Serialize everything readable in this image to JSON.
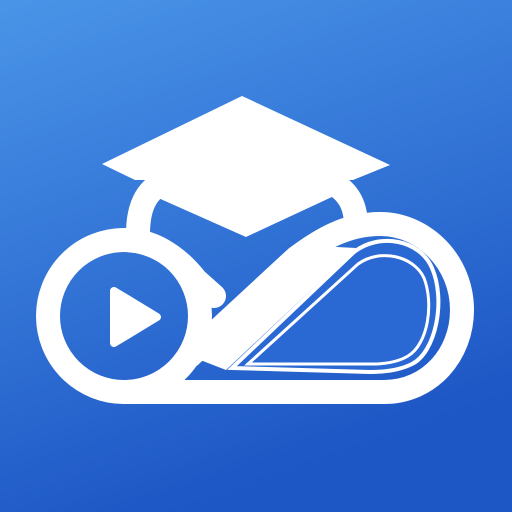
{
  "icon": {
    "name": "education-cloud-app-icon",
    "glyphs": [
      "graduation-cap-icon",
      "cloud-icon",
      "play-icon",
      "teardrop-icon"
    ],
    "colors": {
      "background_top": "#4a95e8",
      "background_bottom": "#1d56c5",
      "glyph": "#ffffff"
    }
  }
}
